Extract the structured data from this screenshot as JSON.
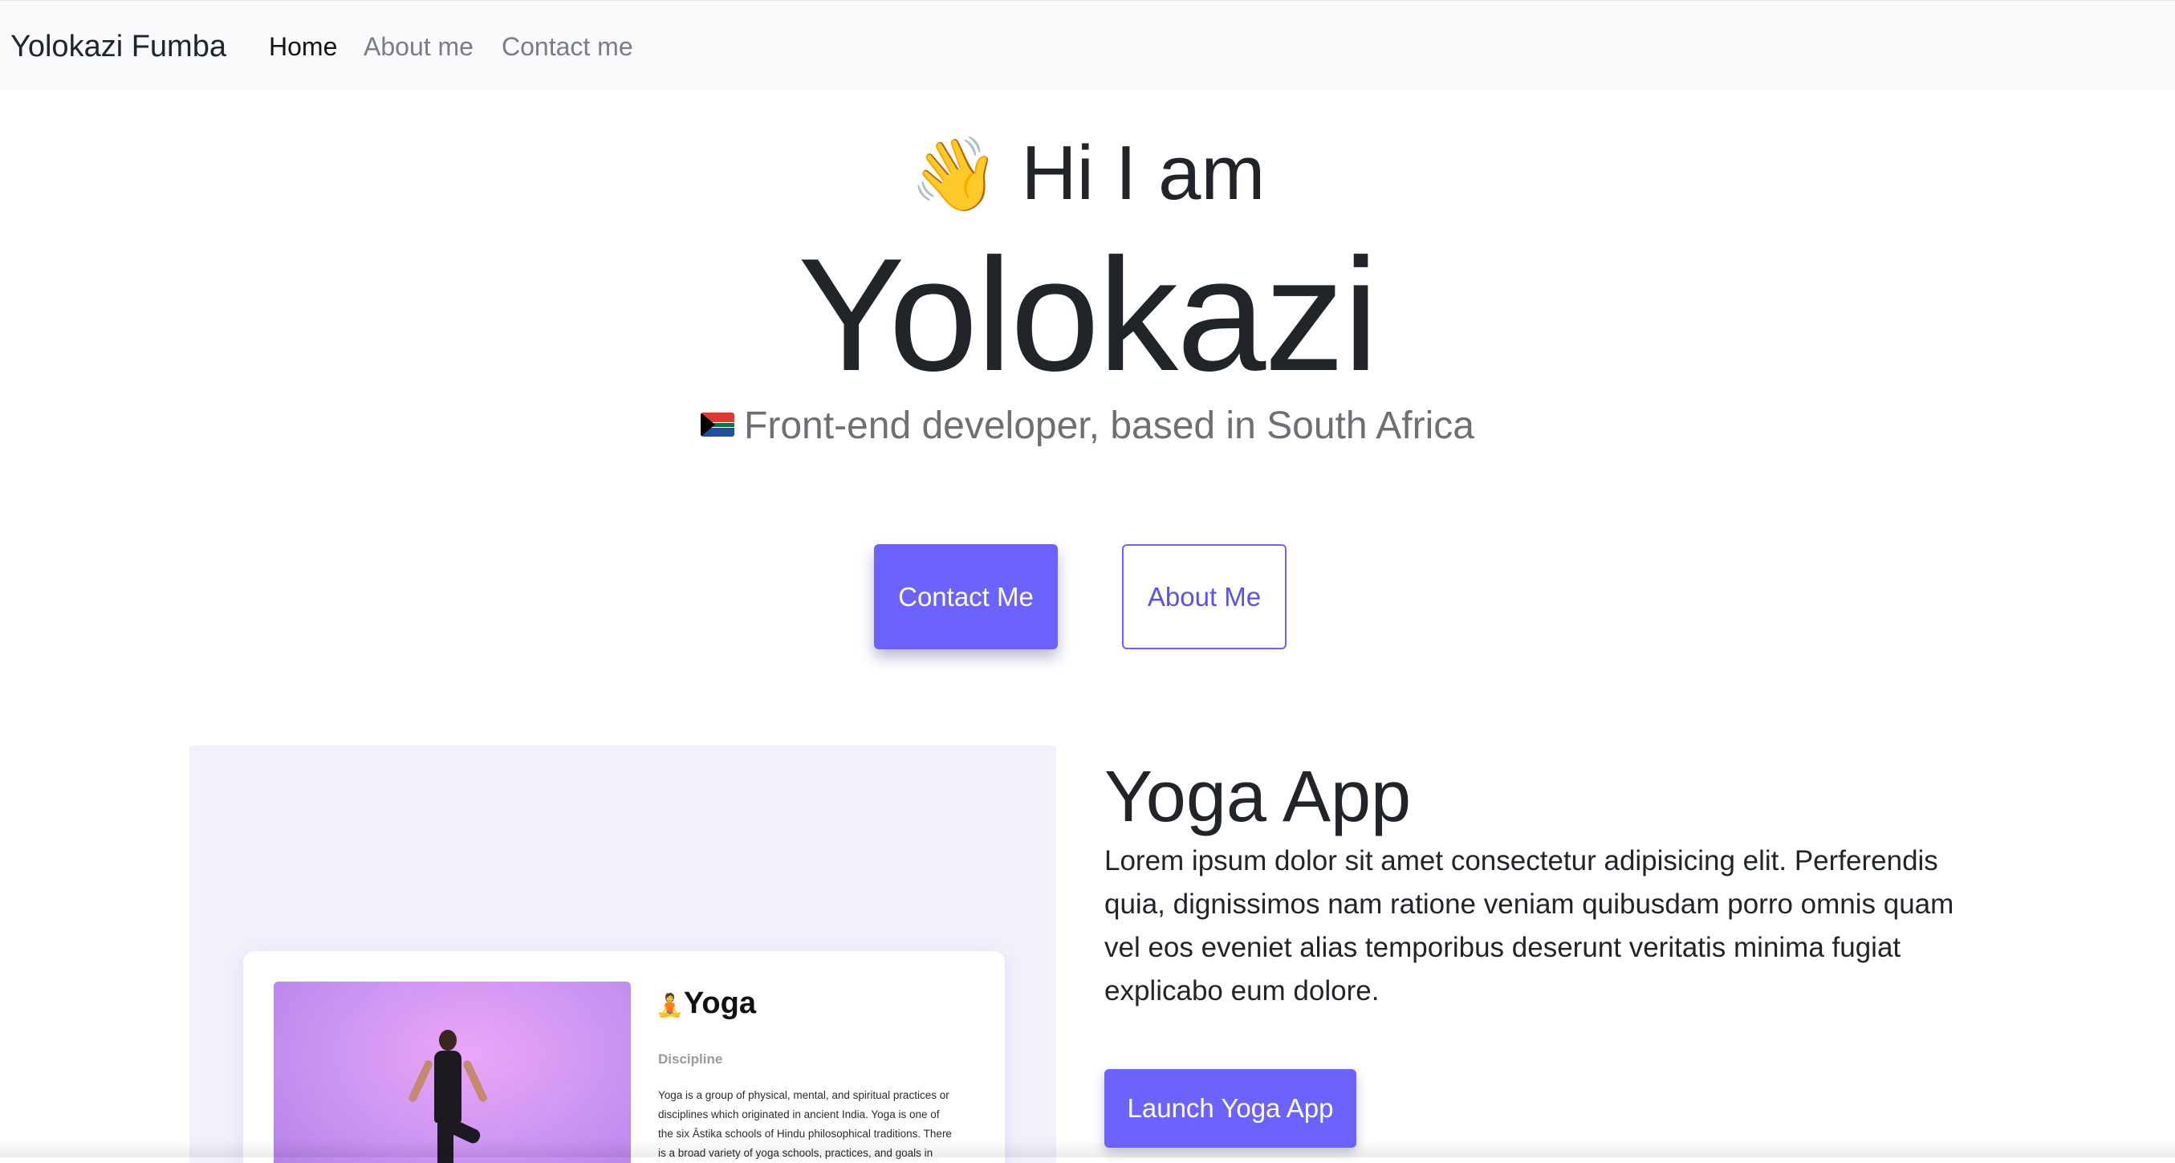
{
  "navbar": {
    "brand": "Yolokazi Fumba",
    "links": [
      {
        "label": "Home",
        "active": true
      },
      {
        "label": "About me",
        "active": false
      },
      {
        "label": "Contact me",
        "active": false
      }
    ]
  },
  "hero": {
    "wave_emoji": "👋",
    "greeting": "Hi I am",
    "name": "Yolokazi",
    "flag_icon": "south-africa-flag-icon",
    "subtitle": "Front-end developer, based in South Africa",
    "buttons": {
      "contact": "Contact Me",
      "about": "About Me"
    }
  },
  "project": {
    "preview": {
      "title_emoji": "🧘",
      "title": "Yoga",
      "discipline_label": "Discipline",
      "description_lines": [
        "Yoga is a group of physical, mental, and spiritual practices or",
        "disciplines which originated in ancient India. Yoga is one of",
        "the six Āstika schools of Hindu philosophical traditions. There",
        "is a broad variety of yoga schools, practices, and goals in"
      ]
    },
    "title": "Yoga App",
    "description": "Lorem ipsum dolor sit amet consectetur adipisicing elit. Perferendis quia, dignissimos nam ratione veniam quibusdam porro omnis quam vel eos eveniet alias temporibus deserunt veritatis minima fugiat explicabo eum dolore.",
    "launch_button": "Launch Yoga App"
  },
  "colors": {
    "accent": "#6c63ff",
    "navbar_bg": "#f8f9fa",
    "card_bg": "#f3f0fc",
    "text": "#212529",
    "muted": "#6c6f73"
  }
}
